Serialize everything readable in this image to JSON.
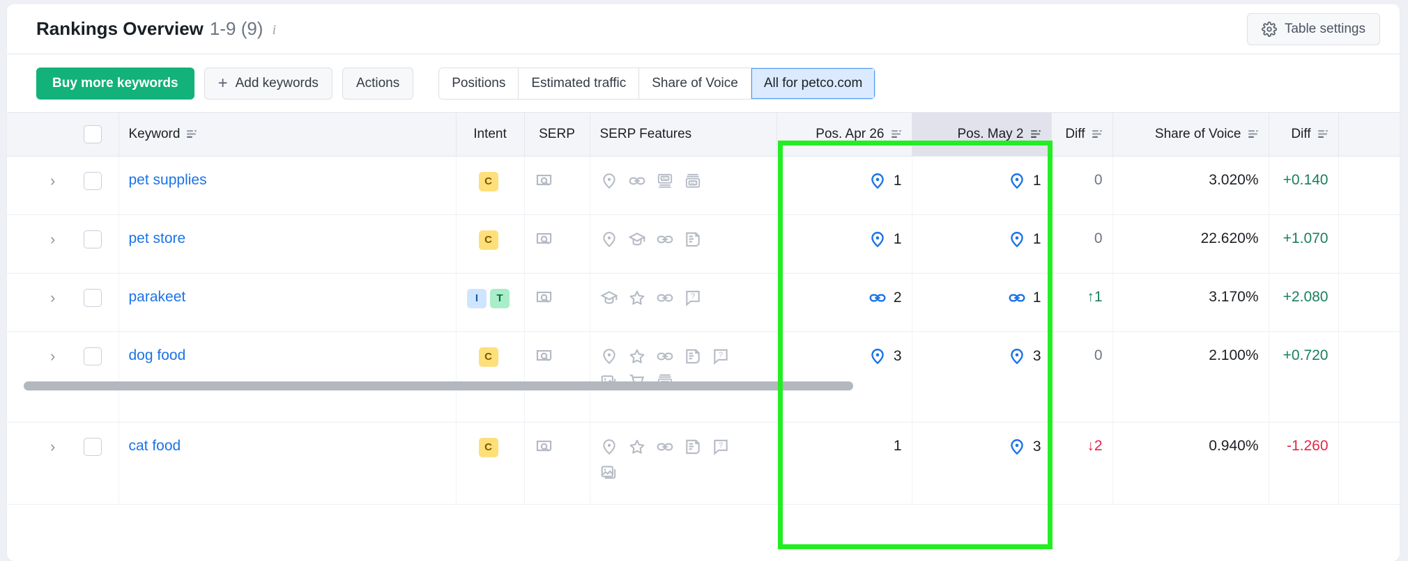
{
  "header": {
    "title": "Rankings Overview",
    "range": "1-9 (9)",
    "info_icon": "info-icon",
    "settings_label": "Table settings",
    "settings_icon": "gear-icon"
  },
  "toolbar": {
    "buy_label": "Buy more keywords",
    "add_label": "Add keywords",
    "add_icon": "plus-icon",
    "actions_label": "Actions",
    "segments": [
      {
        "label": "Positions",
        "active": false
      },
      {
        "label": "Estimated traffic",
        "active": false
      },
      {
        "label": "Share of Voice",
        "active": false
      },
      {
        "label": "All for petco.com",
        "active": true
      }
    ]
  },
  "table": {
    "columns": [
      "Keyword",
      "Intent",
      "SERP",
      "SERP Features",
      "Pos. Apr 26",
      "Pos. May 2",
      "Diff",
      "Share of Voice",
      "Diff"
    ],
    "rows": [
      {
        "keyword": "pet supplies",
        "intents": [
          "C"
        ],
        "serp_features": [
          "pin",
          "link",
          "ad-bottom",
          "ad-top"
        ],
        "pos_apr": "1",
        "pos_apr_icon": "pin",
        "pos_may": "1",
        "pos_may_icon": "pin",
        "pos_diff": "0",
        "pos_diff_dir": "none",
        "sov": "3.020%",
        "sov_diff": "+0.140",
        "sov_diff_dir": "up"
      },
      {
        "keyword": "pet store",
        "intents": [
          "C"
        ],
        "serp_features": [
          "pin",
          "cap",
          "link",
          "document"
        ],
        "pos_apr": "1",
        "pos_apr_icon": "pin",
        "pos_may": "1",
        "pos_may_icon": "pin",
        "pos_diff": "0",
        "pos_diff_dir": "none",
        "sov": "22.620%",
        "sov_diff": "+1.070",
        "sov_diff_dir": "up"
      },
      {
        "keyword": "parakeet",
        "intents": [
          "I",
          "T"
        ],
        "serp_features": [
          "cap",
          "star",
          "link",
          "question"
        ],
        "pos_apr": "2",
        "pos_apr_icon": "link",
        "pos_may": "1",
        "pos_may_icon": "link",
        "pos_diff": "1",
        "pos_diff_dir": "up",
        "sov": "3.170%",
        "sov_diff": "+2.080",
        "sov_diff_dir": "up"
      },
      {
        "keyword": "dog food",
        "intents": [
          "C"
        ],
        "serp_features": [
          "pin",
          "star",
          "link",
          "document",
          "question",
          "images",
          "cart",
          "ad-top"
        ],
        "pos_apr": "3",
        "pos_apr_icon": "pin",
        "pos_may": "3",
        "pos_may_icon": "pin",
        "pos_diff": "0",
        "pos_diff_dir": "none",
        "sov": "2.100%",
        "sov_diff": "+0.720",
        "sov_diff_dir": "up"
      },
      {
        "keyword": "cat food",
        "intents": [
          "C"
        ],
        "serp_features": [
          "pin",
          "star",
          "link",
          "document",
          "question",
          "images"
        ],
        "pos_apr": "1",
        "pos_apr_icon": "none",
        "pos_may": "3",
        "pos_may_icon": "pin",
        "pos_diff": "2",
        "pos_diff_dir": "down",
        "sov": "0.940%",
        "sov_diff": "-1.260",
        "sov_diff_dir": "down"
      }
    ]
  },
  "colors": {
    "primary_green": "#12b27a",
    "link_blue": "#1a73e8",
    "pos_icon_blue": "#1a73e8",
    "up_green": "#1a7f5a",
    "down_red": "#e5254a",
    "highlight_blue": "#dbeafe",
    "annotation_green": "#22ee22"
  }
}
